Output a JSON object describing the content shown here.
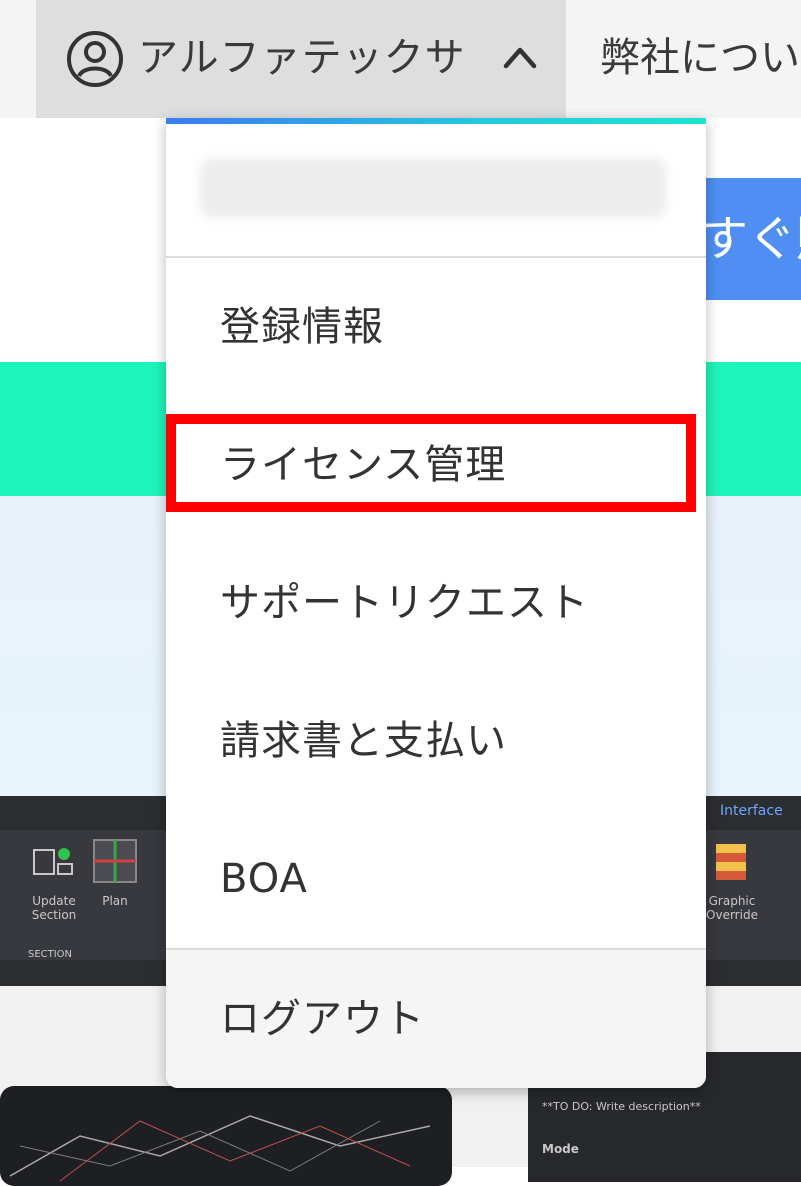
{
  "header": {
    "account_name": "アルファテックサ",
    "user_icon": "user-circle-icon",
    "chevron_icon": "chevron-up-icon",
    "nav_about": "弊社につい"
  },
  "background": {
    "cta_label": "すぐ購",
    "app_ribbon": {
      "update_section": "Update Section",
      "section": "SECTION",
      "plan": "Plan",
      "graphic_override": "Graphic Override",
      "interface": "Interface"
    },
    "thumb_right": {
      "description": "**TO DO: Write description**",
      "mode": "Mode"
    }
  },
  "account_menu": {
    "items": [
      {
        "label": "登録情報"
      },
      {
        "label": "ライセンス管理"
      },
      {
        "label": "サポートリクエスト"
      },
      {
        "label": "請求書と支払い"
      },
      {
        "label": "BOA"
      }
    ],
    "logout": "ログアウト"
  },
  "colors": {
    "accent_gradient_start": "#3a7cf0",
    "accent_gradient_end": "#1ee3cf",
    "teal_band": "#1ef5bb",
    "cta_blue": "#4f8ff4",
    "highlight": "#ff0000"
  }
}
